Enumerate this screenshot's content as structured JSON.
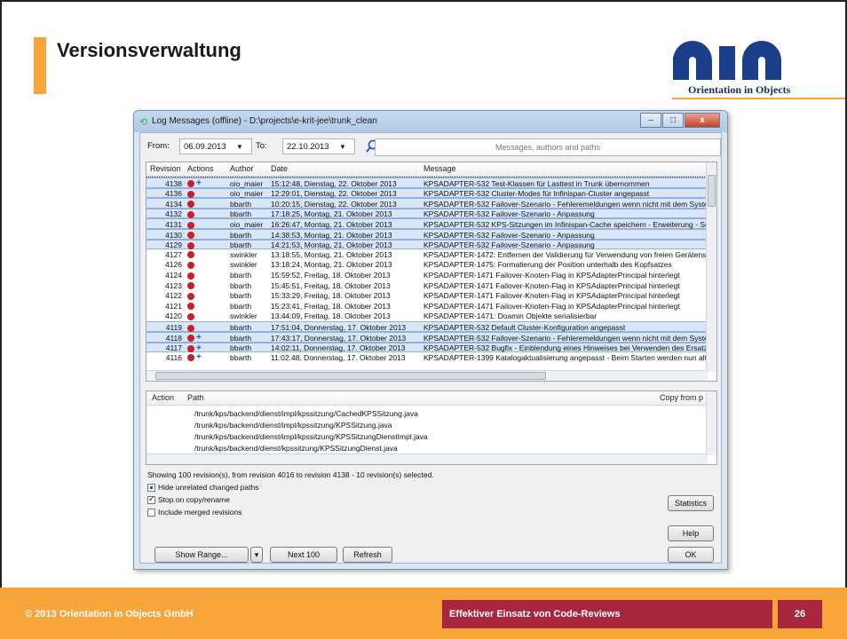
{
  "slide": {
    "title": "Versionsverwaltung",
    "logo_text": "Orientation in Objects",
    "footer_left": "© 2013 Orientation in Objects GmbH",
    "footer_mid": "Effektiver Einsatz von Code-Reviews",
    "page_number": "26"
  },
  "window": {
    "title": "Log Messages (offline) - D:\\projects\\e-krit-jee\\trunk_clean",
    "minimize": "–",
    "maximize": "□",
    "close": "x"
  },
  "filter": {
    "from_label": "From:",
    "from_value": "06.09.2013",
    "to_label": "To:",
    "to_value": "22.10.2013",
    "search_placeholder": "Messages, authors and paths"
  },
  "log": {
    "columns": [
      "Revision",
      "Actions",
      "Author",
      "Date",
      "Message"
    ],
    "rows": [
      {
        "rev": "4138",
        "author": "oio_maier",
        "date": "15:12:48, Dienstag, 22. Oktober 2013",
        "msg": "KPSADAPTER-532 Test-Klassen für Lasttest in Trunk übernommen",
        "sel": true,
        "plus": true
      },
      {
        "rev": "4136",
        "author": "oio_maier",
        "date": "12:29:01, Dienstag, 22. Oktober 2013",
        "msg": "KPSADAPTER-532 Cluster-Modes für Infinispan-Cluster angepasst",
        "sel": true,
        "plus": false
      },
      {
        "rev": "4134",
        "author": "bbarth",
        "date": "10:20:15, Dienstag, 22. Oktober 2013",
        "msg": "KPSADAPTER-532 Failover-Szenario - Fehleremeldungen wenn nicht mit dem System v",
        "sel": true,
        "plus": false
      },
      {
        "rev": "4132",
        "author": "bbarth",
        "date": "17:18:25, Montag, 21. Oktober 2013",
        "msg": "KPSADAPTER-532 Failover-Szenario - Anpassung",
        "sel": true,
        "plus": false
      },
      {
        "rev": "4131",
        "author": "oio_maier",
        "date": "16:26:47, Montag, 21. Oktober 2013",
        "msg": "KPSADAPTER-532 KPS-Sitzungen im Infinispan-Cache speichern - Erweiterung - Seriali",
        "sel": true,
        "plus": false
      },
      {
        "rev": "4130",
        "author": "bbarth",
        "date": "14:38:53, Montag, 21. Oktober 2013",
        "msg": "KPSADAPTER-532 Failover-Szenario - Anpassung",
        "sel": true,
        "plus": false
      },
      {
        "rev": "4129",
        "author": "bbarth",
        "date": "14:21:53, Montag, 21. Oktober 2013",
        "msg": "KPSADAPTER-532 Failover-Szenario - Anpassung",
        "sel": true,
        "plus": false
      },
      {
        "rev": "4127",
        "author": "swinkler",
        "date": "13:18:55, Montag, 21. Oktober 2013",
        "msg": "KPSADAPTER-1472: Entfernen der Validierung für Verwendung von freien Gerätenset",
        "sel": false,
        "plus": false
      },
      {
        "rev": "4126",
        "author": "swinkler",
        "date": "13:18:24, Montag, 21. Oktober 2013",
        "msg": "KPSADAPTER-1475: Formatierung der Position unterhalb des Kopfsatzes",
        "sel": false,
        "plus": false
      },
      {
        "rev": "4124",
        "author": "bbarth",
        "date": "15:59:52, Freitag, 18. Oktober 2013",
        "msg": "KPSADAPTER-1471 Failover-Knoten-Flag in KPSAdapterPrincipal hinterlegt",
        "sel": false,
        "plus": false
      },
      {
        "rev": "4123",
        "author": "bbarth",
        "date": "15:45:51, Freitag, 18. Oktober 2013",
        "msg": "KPSADAPTER-1471 Failover-Knoten-Flag in KPSAdapterPrincipal hinterlegt",
        "sel": false,
        "plus": false
      },
      {
        "rev": "4122",
        "author": "bbarth",
        "date": "15:33:29, Freitag, 18. Oktober 2013",
        "msg": "KPSADAPTER-1471 Failover-Knoten-Flag in KPSAdapterPrincipal hinterlegt",
        "sel": false,
        "plus": false
      },
      {
        "rev": "4121",
        "author": "bbarth",
        "date": "15:23:41, Freitag, 18. Oktober 2013",
        "msg": "KPSADAPTER-1471 Failover-Knoten-Flag in KPSAdapterPrincipal hinterlegt",
        "sel": false,
        "plus": false
      },
      {
        "rev": "4120",
        "author": "swinkler",
        "date": "13:44:09, Freitag, 18. Oktober 2013",
        "msg": "KPSADAPTER-1471: Doamin Objekte serialisierbar",
        "sel": false,
        "plus": false
      },
      {
        "rev": "4119",
        "author": "bbarth",
        "date": "17:51:04, Donnerstag, 17. Oktober 2013",
        "msg": "KPSADAPTER-532 Default Cluster-Konfiguration angepasst",
        "sel": true,
        "plus": false
      },
      {
        "rev": "4118",
        "author": "bbarth",
        "date": "17:43:17, Donnerstag, 17. Oktober 2013",
        "msg": "KPSADAPTER-532 Failover-Szenario - Fehleremeldungen wenn nicht mit dem System v",
        "sel": true,
        "plus": true
      },
      {
        "rev": "4117",
        "author": "bbarth",
        "date": "14:02:11, Donnerstag, 17. Oktober 2013",
        "msg": "KPSADAPTER-532 Bugfix - Einblendung eines Hinweises bei Verwenden des Ersatzsyst",
        "sel": true,
        "plus": true
      },
      {
        "rev": "4116",
        "author": "bbarth",
        "date": "11:02:48, Donnerstag, 17. Oktober 2013",
        "msg": "KPSADAPTER-1399 Katalogaktualisierung angepasst - Beim Starten werden nun alte u",
        "sel": false,
        "plus": true
      }
    ]
  },
  "paths": {
    "columns": [
      "Action",
      "Path",
      "Copy from p"
    ],
    "rows": [
      "/trunk/kps/backend/dienst/impl/kpssitzung/CachedKPSSitzung.java",
      "/trunk/kps/backend/dienst/impl/kpssitzung/KPSSitzung.java",
      "/trunk/kps/backend/dienst/impl/kpssitzung/KPSSitzungDienstImpl.java",
      "/trunk/kps/backend/dienst/kpssitzung/KPSSitzungDienst.java"
    ]
  },
  "status_text": "Showing 100 revision(s), from revision 4016 to revision 4138 - 10 revision(s) selected.",
  "options": {
    "hide_unrelated": "Hide unrelated changed paths",
    "stop_on_copy": "Stop on copy/rename",
    "include_merged": "Include merged revisions"
  },
  "buttons": {
    "show_range": "Show Range...",
    "next_100": "Next 100",
    "refresh": "Refresh",
    "statistics": "Statistics",
    "help": "Help",
    "ok": "OK"
  },
  "colors": {
    "accent": "#f7a43b",
    "footer_box": "#a8273e",
    "selection": "#d8e6f7"
  }
}
